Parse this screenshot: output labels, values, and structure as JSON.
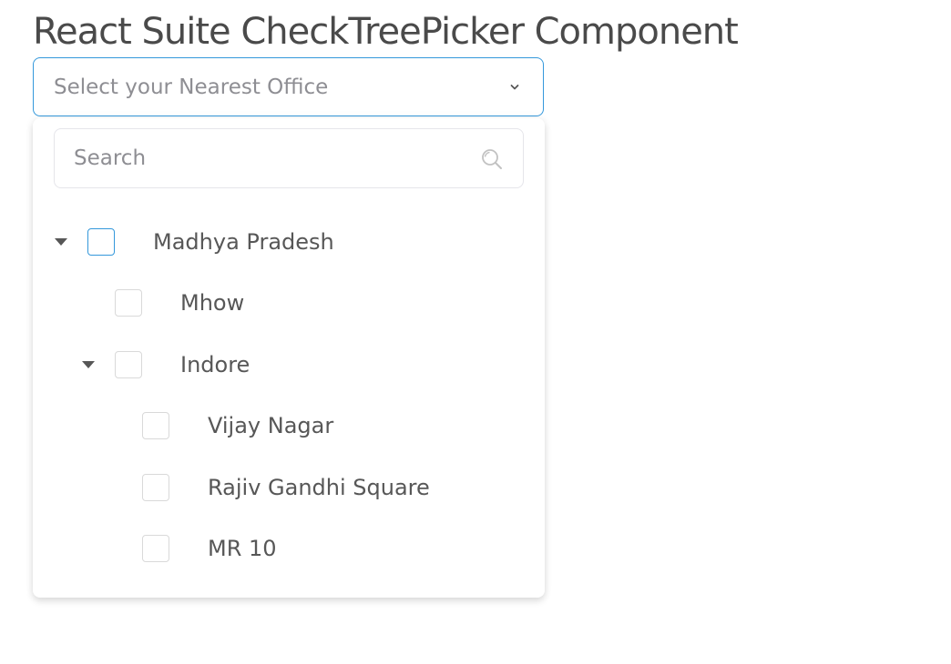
{
  "page": {
    "title": "React Suite CheckTreePicker Component"
  },
  "picker": {
    "placeholder": "Select your Nearest Office",
    "caret_icon": "chevron-down-icon",
    "accent_color": "#3498db"
  },
  "menu": {
    "search": {
      "placeholder": "Search",
      "value": "",
      "icon": "search-icon"
    },
    "tree": [
      {
        "label": "Madhya Pradesh",
        "level": 0,
        "expandable": true,
        "expanded": true,
        "checked": false
      },
      {
        "label": "Mhow",
        "level": 1,
        "expandable": false,
        "checked": false
      },
      {
        "label": "Indore",
        "level": 1,
        "expandable": true,
        "expanded": true,
        "checked": false
      },
      {
        "label": "Vijay Nagar",
        "level": 2,
        "expandable": false,
        "checked": false
      },
      {
        "label": "Rajiv Gandhi Square",
        "level": 2,
        "expandable": false,
        "checked": false
      },
      {
        "label": "MR 10",
        "level": 2,
        "expandable": false,
        "checked": false
      }
    ]
  }
}
